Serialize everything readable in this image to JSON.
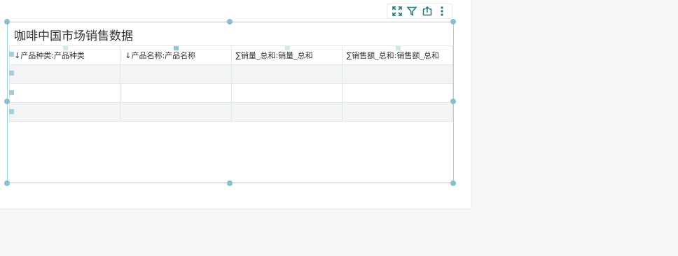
{
  "widget": {
    "title": "咖啡中国市场销售数据",
    "columns": [
      "↓产品种类:产品种类",
      "↓产品名称:产品名称",
      "∑销量_总和:销量_总和",
      "∑销售额_总和:销售额_总和"
    ],
    "rows": [
      [
        "",
        "",
        "",
        ""
      ],
      [
        "",
        "",
        "",
        ""
      ],
      [
        "",
        "",
        "",
        ""
      ]
    ]
  },
  "toolbar": {
    "icons": [
      "fullscreen-icon",
      "filter-icon",
      "export-icon",
      "more-vertical-icon"
    ]
  },
  "colors": {
    "accent": "#1f7a7a",
    "selection_border": "#9fd3df",
    "handle": "#86c0cf",
    "stripe": "#f3f4f4"
  }
}
